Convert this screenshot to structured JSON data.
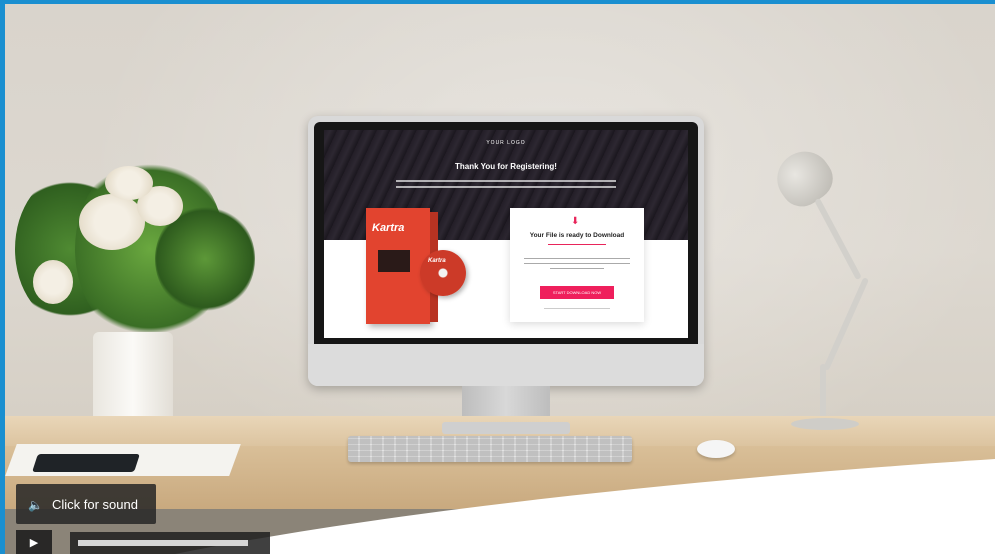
{
  "video_controls": {
    "sound_label": "Click for sound",
    "sound_icon": "speaker-icon",
    "play_icon": "play-icon"
  },
  "screen_page": {
    "logo": "YOUR LOGO",
    "heading": "Thank You for Registering!",
    "product_title": "Kartra",
    "disc_title": "Kartra",
    "card": {
      "title": "Your File is ready to Download",
      "button_label": "START DOWNLOAD NOW"
    }
  },
  "colors": {
    "accent": "#ef1f5c",
    "frame_border": "#1a8fd0",
    "product_red": "#e2442f"
  }
}
